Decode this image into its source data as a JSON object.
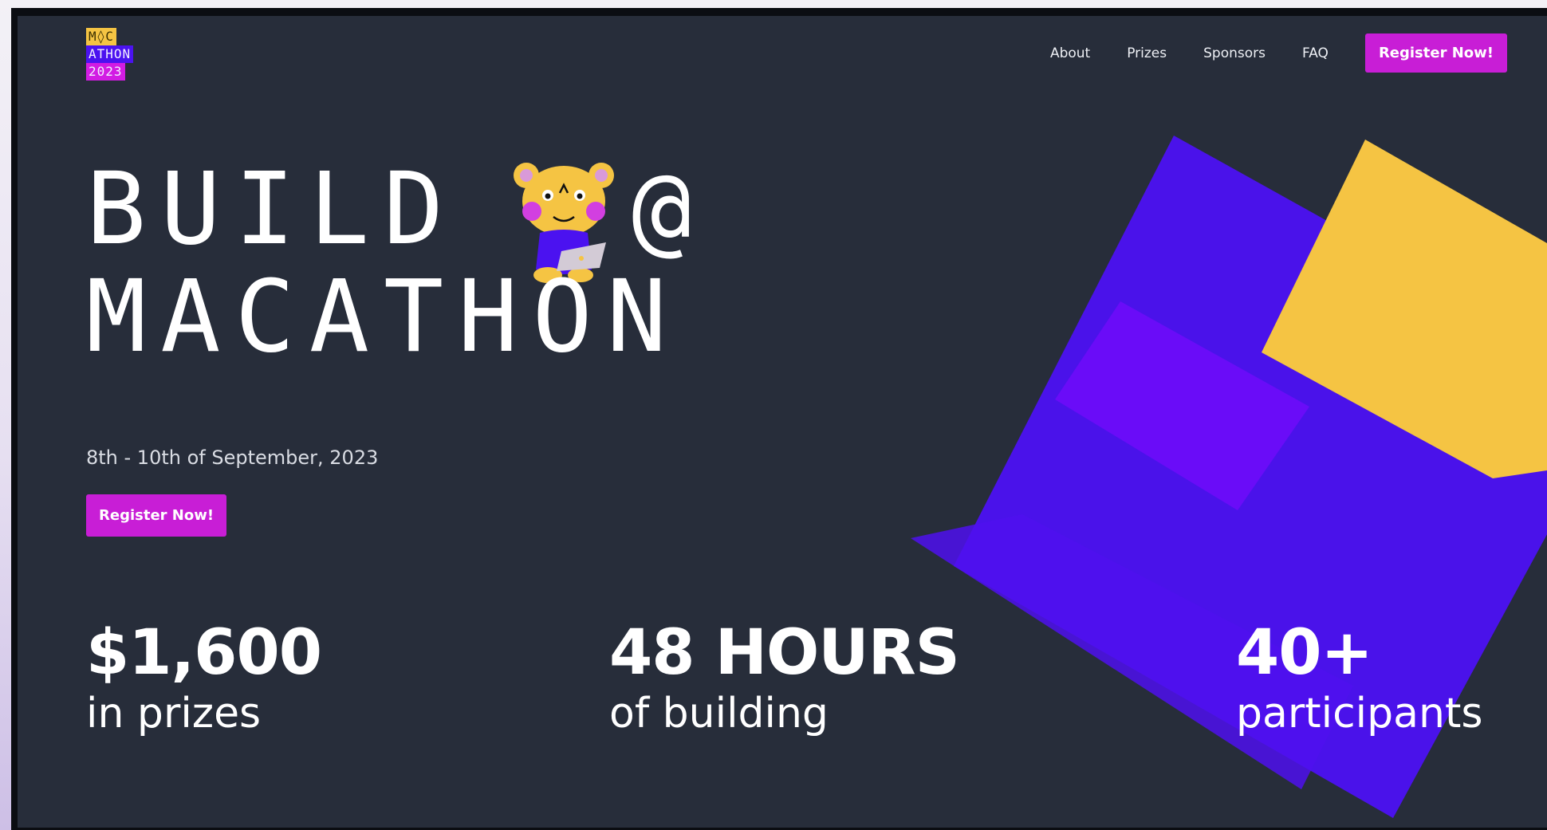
{
  "logo": {
    "line1": "M◊C",
    "line2": "ATHON",
    "line3": "2023"
  },
  "nav": {
    "items": [
      {
        "label": "About"
      },
      {
        "label": "Prizes"
      },
      {
        "label": "Sponsors"
      },
      {
        "label": "FAQ"
      }
    ],
    "cta_label": "Register Now!"
  },
  "hero": {
    "line1": "BUILD",
    "at_symbol": "@",
    "line2": "MACATHON",
    "date": "8th - 10th of September, 2023",
    "cta_label": "Register Now!"
  },
  "stats": [
    {
      "value": "$1,600",
      "label": "in prizes"
    },
    {
      "value": "48 HOURS",
      "label": "of building"
    },
    {
      "value": "40+",
      "label": "participants"
    }
  ],
  "colors": {
    "background": "#272d3a",
    "accent_magenta": "#c81ed6",
    "shape_blue": "#4b12f0",
    "shape_purple": "#6a0cf8",
    "shape_yellow": "#f5c443"
  },
  "icons": {
    "mascot": "bear-with-laptop-icon"
  }
}
